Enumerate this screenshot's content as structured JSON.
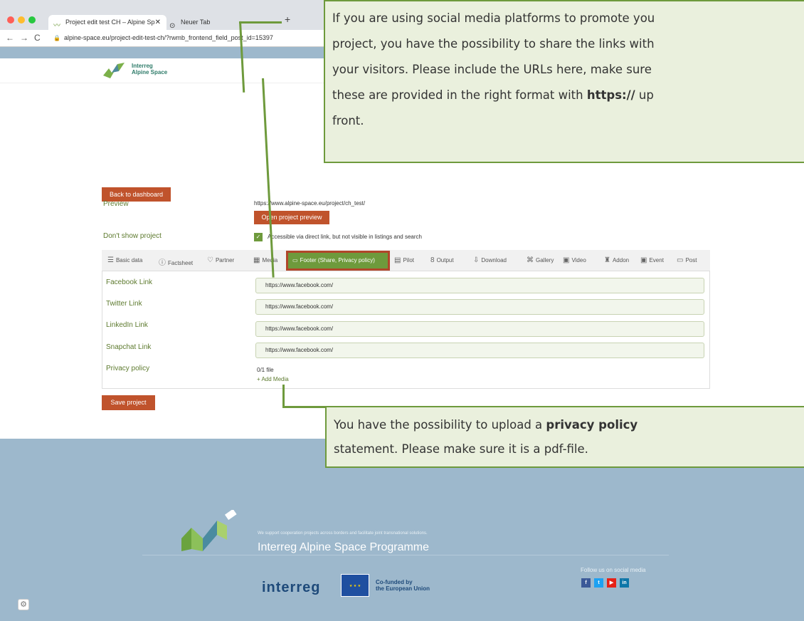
{
  "browser": {
    "tabs": [
      {
        "label": "Project edit test CH – Alpine Sp",
        "icon": "interreg-favicon"
      },
      {
        "label": "Neuer Tab",
        "icon": "chrome-icon"
      }
    ],
    "url": "alpine-space.eu/project-edit-test-ch/?rwmb_frontend_field_post_id=15397"
  },
  "header": {
    "logo_line1": "Interreg",
    "logo_line2": "Alpine Space"
  },
  "page": {
    "back_label": "Back to dashboard",
    "preview_label": "Preview",
    "preview_url": "https://www.alpine-space.eu/project/ch_test/",
    "preview_button": "Open project preview",
    "dont_show_label": "Don't show project",
    "dont_show_text": "Accessible via direct link, but not visible in listings and search",
    "save_label": "Save project"
  },
  "edit_tabs": [
    {
      "label": "Basic data",
      "icon": "list-icon"
    },
    {
      "label": "Factsheet",
      "icon": "info-icon"
    },
    {
      "label": "Partner",
      "icon": "handshake-icon"
    },
    {
      "label": "Media",
      "icon": "media-icon"
    },
    {
      "label": "Footer (Share, Privacy policy)",
      "icon": "footer-icon"
    },
    {
      "label": "Pilot",
      "icon": "pilot-icon"
    },
    {
      "label": "Output",
      "icon": "output-icon"
    },
    {
      "label": "Download",
      "icon": "download-icon"
    },
    {
      "label": "Gallery",
      "icon": "gallery-icon"
    },
    {
      "label": "Video",
      "icon": "video-icon"
    },
    {
      "label": "Addon",
      "icon": "addon-icon"
    },
    {
      "label": "Event",
      "icon": "calendar-icon"
    },
    {
      "label": "Post",
      "icon": "post-icon"
    }
  ],
  "fields": [
    {
      "label": "Facebook Link",
      "value": "https://www.facebook.com/"
    },
    {
      "label": "Twitter Link",
      "value": "https://www.facebook.com/"
    },
    {
      "label": "LinkedIn Link",
      "value": "https://www.facebook.com/"
    },
    {
      "label": "Snapchat Link",
      "value": "https://www.facebook.com/"
    }
  ],
  "privacy": {
    "label": "Privacy policy",
    "file_count": "0/1 file",
    "add_media": "+ Add Media"
  },
  "callouts": {
    "top_lines": [
      "If you are using social media platforms to promote you",
      "project, you have the possibility to share the links with",
      "your visitors. Please include the URLs here, make sure"
    ],
    "top_line4_pre": "these are provided in the right format with ",
    "top_line4_bold": "https://",
    "top_line4_post": " up",
    "top_line5": "front.",
    "bottom_line1_pre": "You have the possibility to upload a ",
    "bottom_line1_bold": "privacy policy",
    "bottom_line2": "statement. Please make sure it is a pdf-file."
  },
  "footer": {
    "tagline": "We support cooperation projects across borders and facilitate joint transnational solutions.",
    "title": "Interreg Alpine Space Programme",
    "interreg": "interreg",
    "cofunded_line1": "Co-funded by",
    "cofunded_line2": "the European Union",
    "follow": "Follow us on social media",
    "social": [
      "f",
      "t",
      "▶",
      "in"
    ]
  },
  "colors": {
    "accent_green": "#6e9a3c",
    "rust": "#c0532c",
    "footer_blue": "#9db8cc"
  }
}
